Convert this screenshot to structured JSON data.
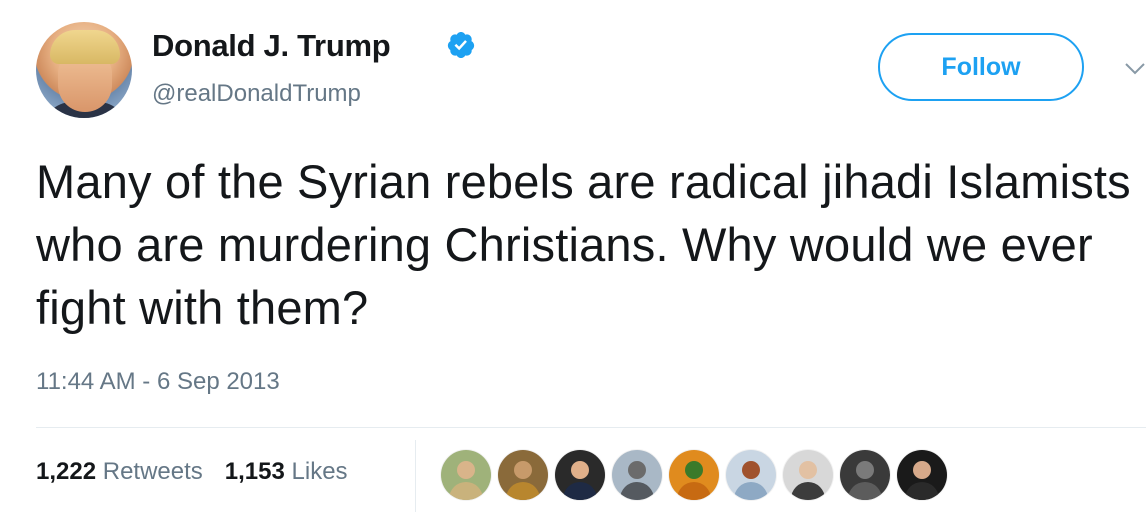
{
  "author": {
    "name": "Donald J. Trump",
    "handle": "@realDonaldTrump",
    "verified": true
  },
  "actions": {
    "follow_label": "Follow"
  },
  "tweet": {
    "text": "Many of the Syrian rebels are radical jihadi Islamists who are murdering Christians. Why would we ever fight with them?",
    "timestamp": "11:44 AM - 6 Sep 2013"
  },
  "stats": {
    "retweets_count": "1,222",
    "retweets_label": "Retweets",
    "likes_count": "1,153",
    "likes_label": "Likes"
  },
  "colors": {
    "accent": "#1da1f2",
    "text_primary": "#14171a",
    "text_secondary": "#657786",
    "divider": "#e6ecf0"
  },
  "icons": {
    "verified": "verified-badge-icon",
    "menu": "chevron-down-icon"
  },
  "liker_avatars": [
    {
      "bg": "#9fb27a",
      "skin": "#d9b48a",
      "body": "#c9b27c"
    },
    {
      "bg": "#8a6a3a",
      "skin": "#c79a6a",
      "body": "#b8862e"
    },
    {
      "bg": "#2a2a2a",
      "skin": "#e0b08a",
      "body": "#1e2a44"
    },
    {
      "bg": "#a9b8c6",
      "skin": "#6b6b6b",
      "body": "#555a60"
    },
    {
      "bg": "#e08b1e",
      "skin": "#3a7a2a",
      "body": "#c76a12"
    },
    {
      "bg": "#c9d6e3",
      "skin": "#a0522d",
      "body": "#8ea9c4"
    },
    {
      "bg": "#d8d8d8",
      "skin": "#e2c1a3",
      "body": "#3c3c3c"
    },
    {
      "bg": "#3a3a3a",
      "skin": "#7a7a7a",
      "body": "#5c5c5c"
    },
    {
      "bg": "#1a1a1a",
      "skin": "#d6a98a",
      "body": "#2a2a2a"
    }
  ]
}
